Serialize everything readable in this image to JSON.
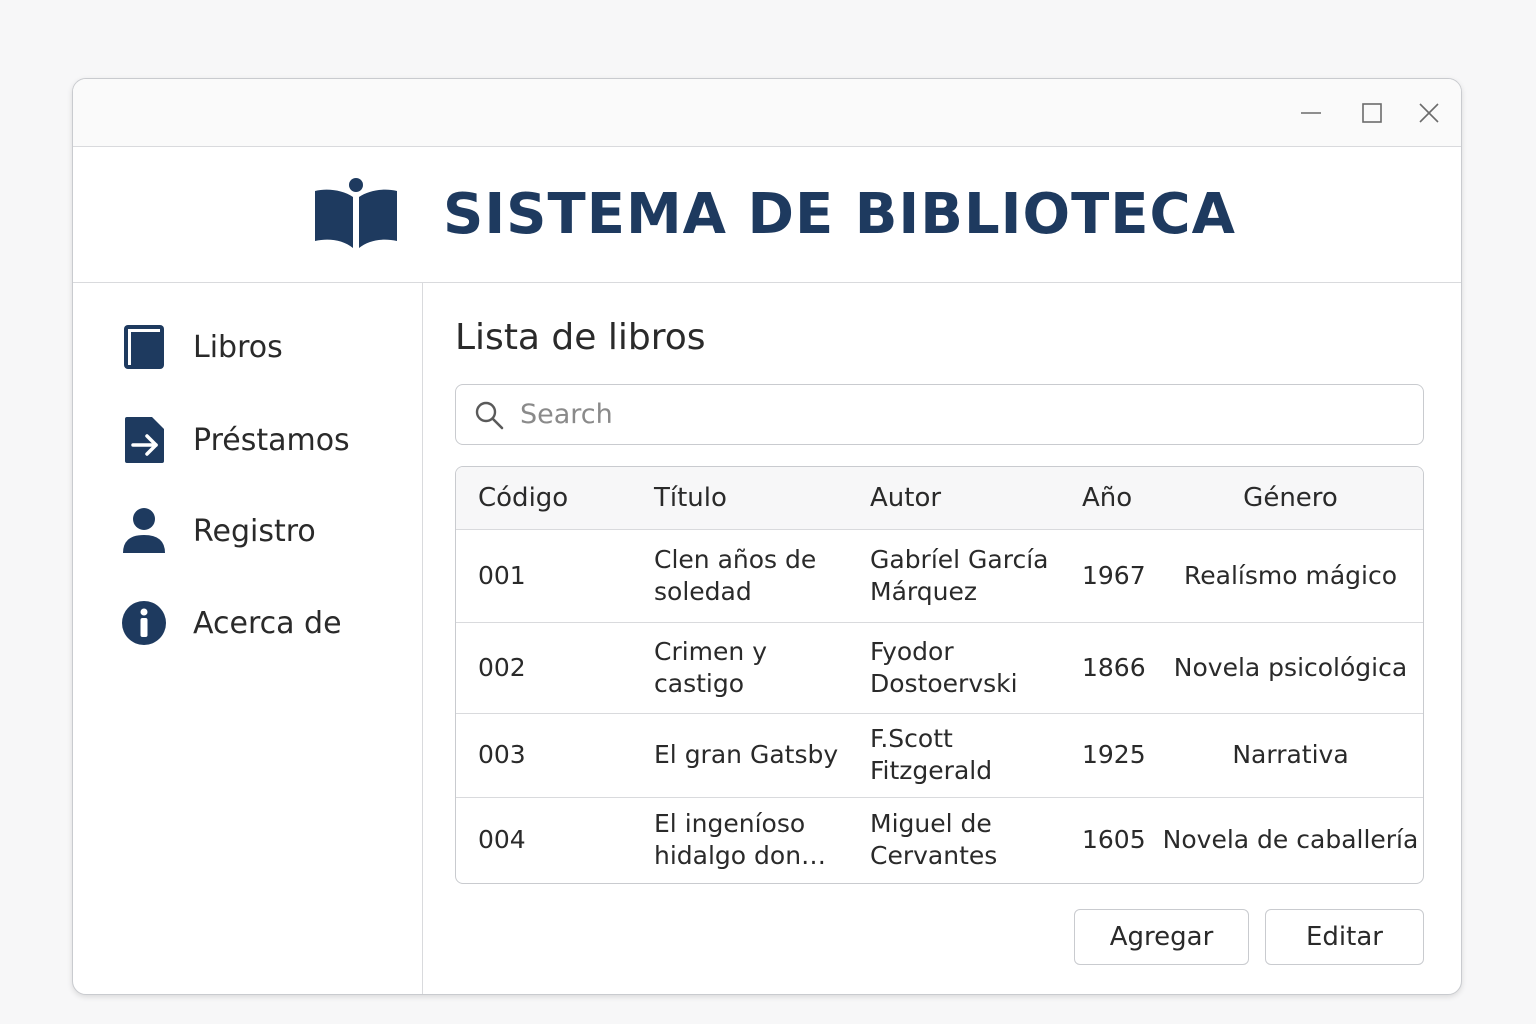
{
  "window": {
    "controls": {
      "minimize_icon": "minimize-icon",
      "maximize_icon": "maximize-icon",
      "close_icon": "close-icon"
    }
  },
  "header": {
    "title": "SISTEMA DE BIBLIOTECA",
    "logo_icon": "open-book-icon",
    "brand_color": "#1e3a5f"
  },
  "sidebar": {
    "items": [
      {
        "label": "Libros",
        "icon": "book-icon"
      },
      {
        "label": "Préstamos",
        "icon": "loan-icon"
      },
      {
        "label": "Registro",
        "icon": "user-icon"
      },
      {
        "label": "Acerca de",
        "icon": "info-icon"
      }
    ]
  },
  "main": {
    "title": "Lista de libros",
    "search": {
      "placeholder": "Search",
      "value": ""
    },
    "table": {
      "columns": [
        "Código",
        "Título",
        "Autor",
        "Año",
        "Género"
      ],
      "rows": [
        {
          "codigo": "001",
          "titulo": "Clen años de soledad",
          "autor": "Gabríel García Márquez",
          "anio": "1967",
          "genero": "Realísmo mágico"
        },
        {
          "codigo": "002",
          "titulo": "Crimen y castigo",
          "autor": "Fyodor Dostoervski",
          "anio": "1866",
          "genero": "Novela psicológica"
        },
        {
          "codigo": "003",
          "titulo": "El gran Gatsby",
          "autor": "F.Scott Fitzgerald",
          "anio": "1925",
          "genero": "Narrativa"
        },
        {
          "codigo": "004",
          "titulo": "El ingeníoso hidalgo don Qu…",
          "autor": "Miguel de Cervantes",
          "anio": "1605",
          "genero": "Novela de caballería"
        }
      ]
    },
    "buttons": {
      "add": "Agregar",
      "edit": "Editar"
    }
  }
}
